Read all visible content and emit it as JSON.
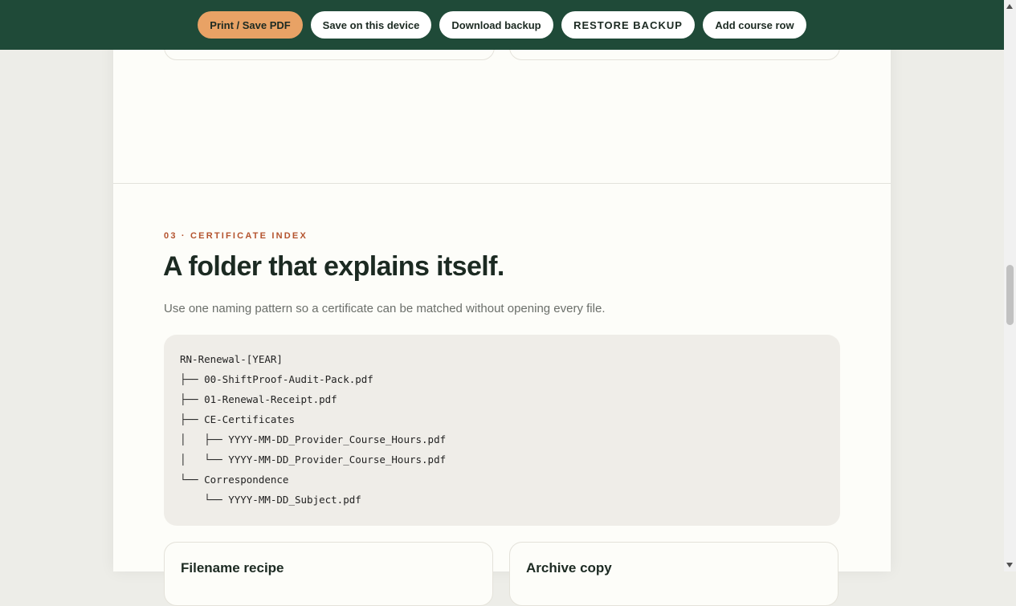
{
  "toolbar": {
    "print_label": "Print / Save PDF",
    "save_device_label": "Save on this device",
    "download_label": "Download backup",
    "restore_label": "RESTORE BACKUP",
    "add_row_label": "Add course row"
  },
  "section": {
    "eyebrow": "03 · CERTIFICATE INDEX",
    "title": "A folder that explains itself.",
    "lede": "Use one naming pattern so a certificate can be matched without opening every file."
  },
  "tree": [
    "RN-Renewal-[YEAR]",
    "├── 00-ShiftProof-Audit-Pack.pdf",
    "├── 01-Renewal-Receipt.pdf",
    "├── CE-Certificates",
    "│   ├── YYYY-MM-DD_Provider_Course_Hours.pdf",
    "│   └── YYYY-MM-DD_Provider_Course_Hours.pdf",
    "└── Correspondence",
    "    └── YYYY-MM-DD_Subject.pdf"
  ],
  "cards": {
    "filename_recipe": "Filename recipe",
    "archive_copy": "Archive copy"
  },
  "colors": {
    "topbar": "#1f4a38",
    "primary_button": "#e8a265",
    "eyebrow": "#b4532e"
  }
}
